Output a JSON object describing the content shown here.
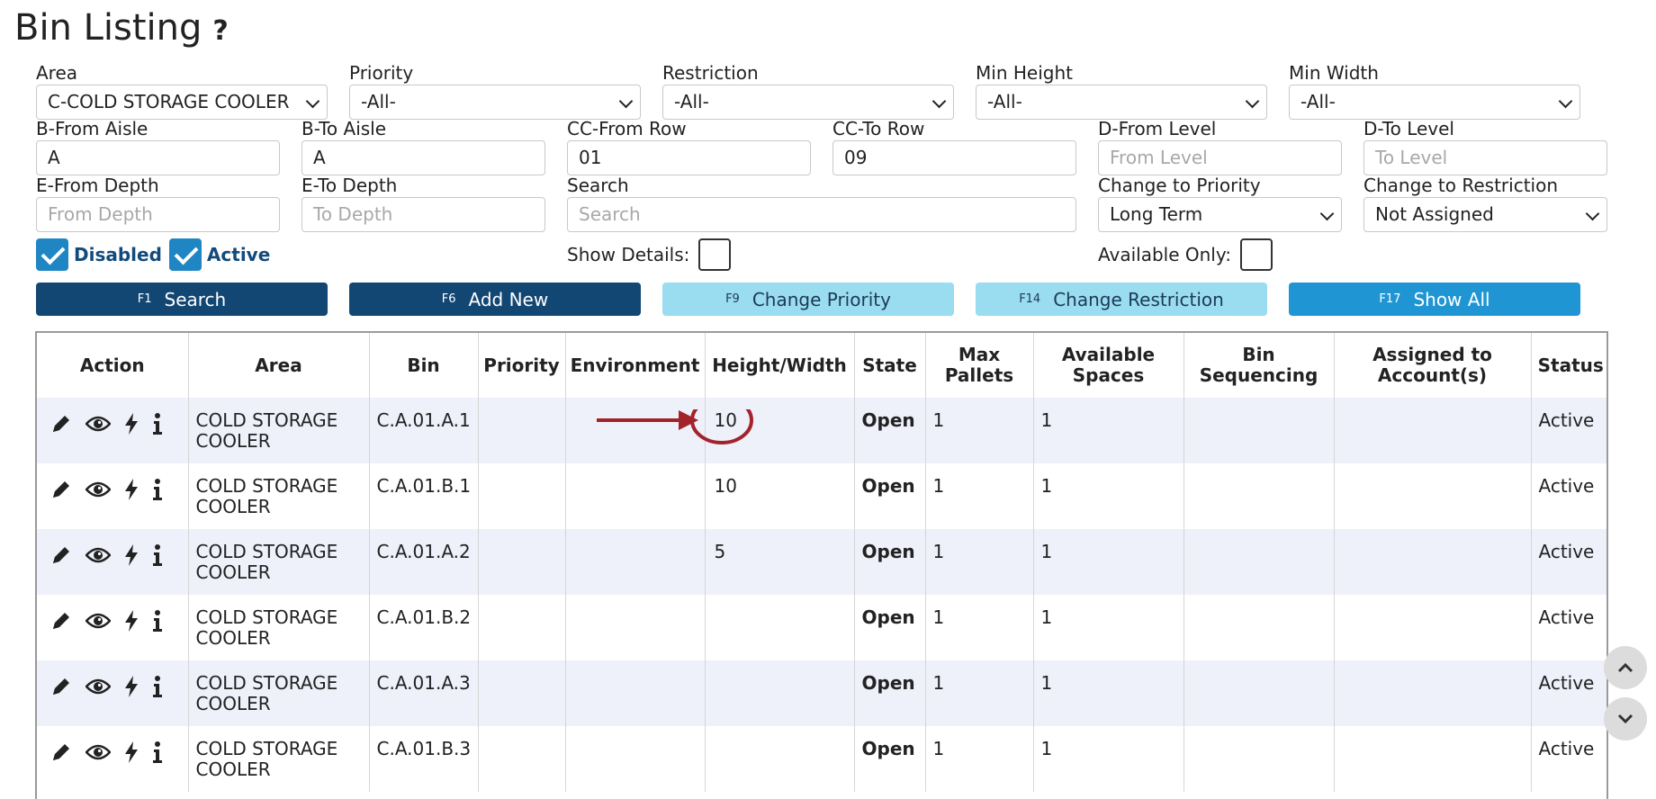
{
  "page": {
    "title": "Bin Listing",
    "help_icon": "?"
  },
  "filters": {
    "area": {
      "label": "Area",
      "value": "C-COLD STORAGE COOLER"
    },
    "priority": {
      "label": "Priority",
      "value": "-All-"
    },
    "restriction": {
      "label": "Restriction",
      "value": "-All-"
    },
    "min_height": {
      "label": "Min Height",
      "value": "-All-"
    },
    "min_width": {
      "label": "Min Width",
      "value": "-All-"
    },
    "from_aisle": {
      "label": "B-From Aisle",
      "value": "A"
    },
    "to_aisle": {
      "label": "B-To Aisle",
      "value": "A"
    },
    "from_row": {
      "label": "CC-From Row",
      "value": "01"
    },
    "to_row": {
      "label": "CC-To Row",
      "value": "09"
    },
    "from_level": {
      "label": "D-From Level",
      "value": "",
      "placeholder": "From Level"
    },
    "to_level": {
      "label": "D-To Level",
      "value": "",
      "placeholder": "To Level"
    },
    "from_depth": {
      "label": "E-From Depth",
      "value": "",
      "placeholder": "From Depth"
    },
    "to_depth": {
      "label": "E-To Depth",
      "value": "",
      "placeholder": "To Depth"
    },
    "search": {
      "label": "Search",
      "value": "",
      "placeholder": "Search"
    },
    "change_priority": {
      "label": "Change to Priority",
      "value": "Long Term"
    },
    "change_restriction": {
      "label": "Change to Restriction",
      "value": "Not Assigned"
    }
  },
  "checkboxes": {
    "disabled": {
      "label": "Disabled",
      "checked": true
    },
    "active": {
      "label": "Active",
      "checked": true
    },
    "show_details": {
      "label": "Show Details:",
      "checked": false
    },
    "available_only": {
      "label": "Available Only:",
      "checked": false
    }
  },
  "buttons": {
    "search": {
      "key": "F1",
      "label": "Search"
    },
    "add_new": {
      "key": "F6",
      "label": "Add New"
    },
    "change_priority": {
      "key": "F9",
      "label": "Change Priority"
    },
    "change_restriction": {
      "key": "F14",
      "label": "Change Restriction"
    },
    "show_all": {
      "key": "F17",
      "label": "Show All"
    }
  },
  "table": {
    "headers": [
      "Action",
      "Area",
      "Bin",
      "Priority",
      "Environment",
      "Height/Width",
      "State",
      "Max Pallets",
      "Available Spaces",
      "Bin Sequencing",
      "Assigned to Account(s)",
      "Status"
    ],
    "rows": [
      {
        "area": "COLD STORAGE COOLER",
        "bin": "C.A.01.A.1",
        "priority": "",
        "environment": "",
        "height_width": "10",
        "state": "Open",
        "max_pallets": "1",
        "available_spaces": "1",
        "bin_sequencing": "",
        "accounts": "",
        "status": "Active"
      },
      {
        "area": "COLD STORAGE COOLER",
        "bin": "C.A.01.B.1",
        "priority": "",
        "environment": "",
        "height_width": "10",
        "state": "Open",
        "max_pallets": "1",
        "available_spaces": "1",
        "bin_sequencing": "",
        "accounts": "",
        "status": "Active"
      },
      {
        "area": "COLD STORAGE COOLER",
        "bin": "C.A.01.A.2",
        "priority": "",
        "environment": "",
        "height_width": "5",
        "state": "Open",
        "max_pallets": "1",
        "available_spaces": "1",
        "bin_sequencing": "",
        "accounts": "",
        "status": "Active"
      },
      {
        "area": "COLD STORAGE COOLER",
        "bin": "C.A.01.B.2",
        "priority": "",
        "environment": "",
        "height_width": "",
        "state": "Open",
        "max_pallets": "1",
        "available_spaces": "1",
        "bin_sequencing": "",
        "accounts": "",
        "status": "Active"
      },
      {
        "area": "COLD STORAGE COOLER",
        "bin": "C.A.01.A.3",
        "priority": "",
        "environment": "",
        "height_width": "",
        "state": "Open",
        "max_pallets": "1",
        "available_spaces": "1",
        "bin_sequencing": "",
        "accounts": "",
        "status": "Active"
      },
      {
        "area": "COLD STORAGE COOLER",
        "bin": "C.A.01.B.3",
        "priority": "",
        "environment": "",
        "height_width": "",
        "state": "Open",
        "max_pallets": "1",
        "available_spaces": "1",
        "bin_sequencing": "",
        "accounts": "",
        "status": "Active"
      }
    ],
    "row_action_icons": [
      "pencil-icon",
      "eye-icon",
      "lightning-icon",
      "info-icon"
    ]
  },
  "annotation": {
    "color": "#a3232b"
  },
  "colors": {
    "primary": "#124673",
    "light": "#9adcf0",
    "accent": "#1f96d3",
    "row_stripe": "#eef0fa"
  }
}
